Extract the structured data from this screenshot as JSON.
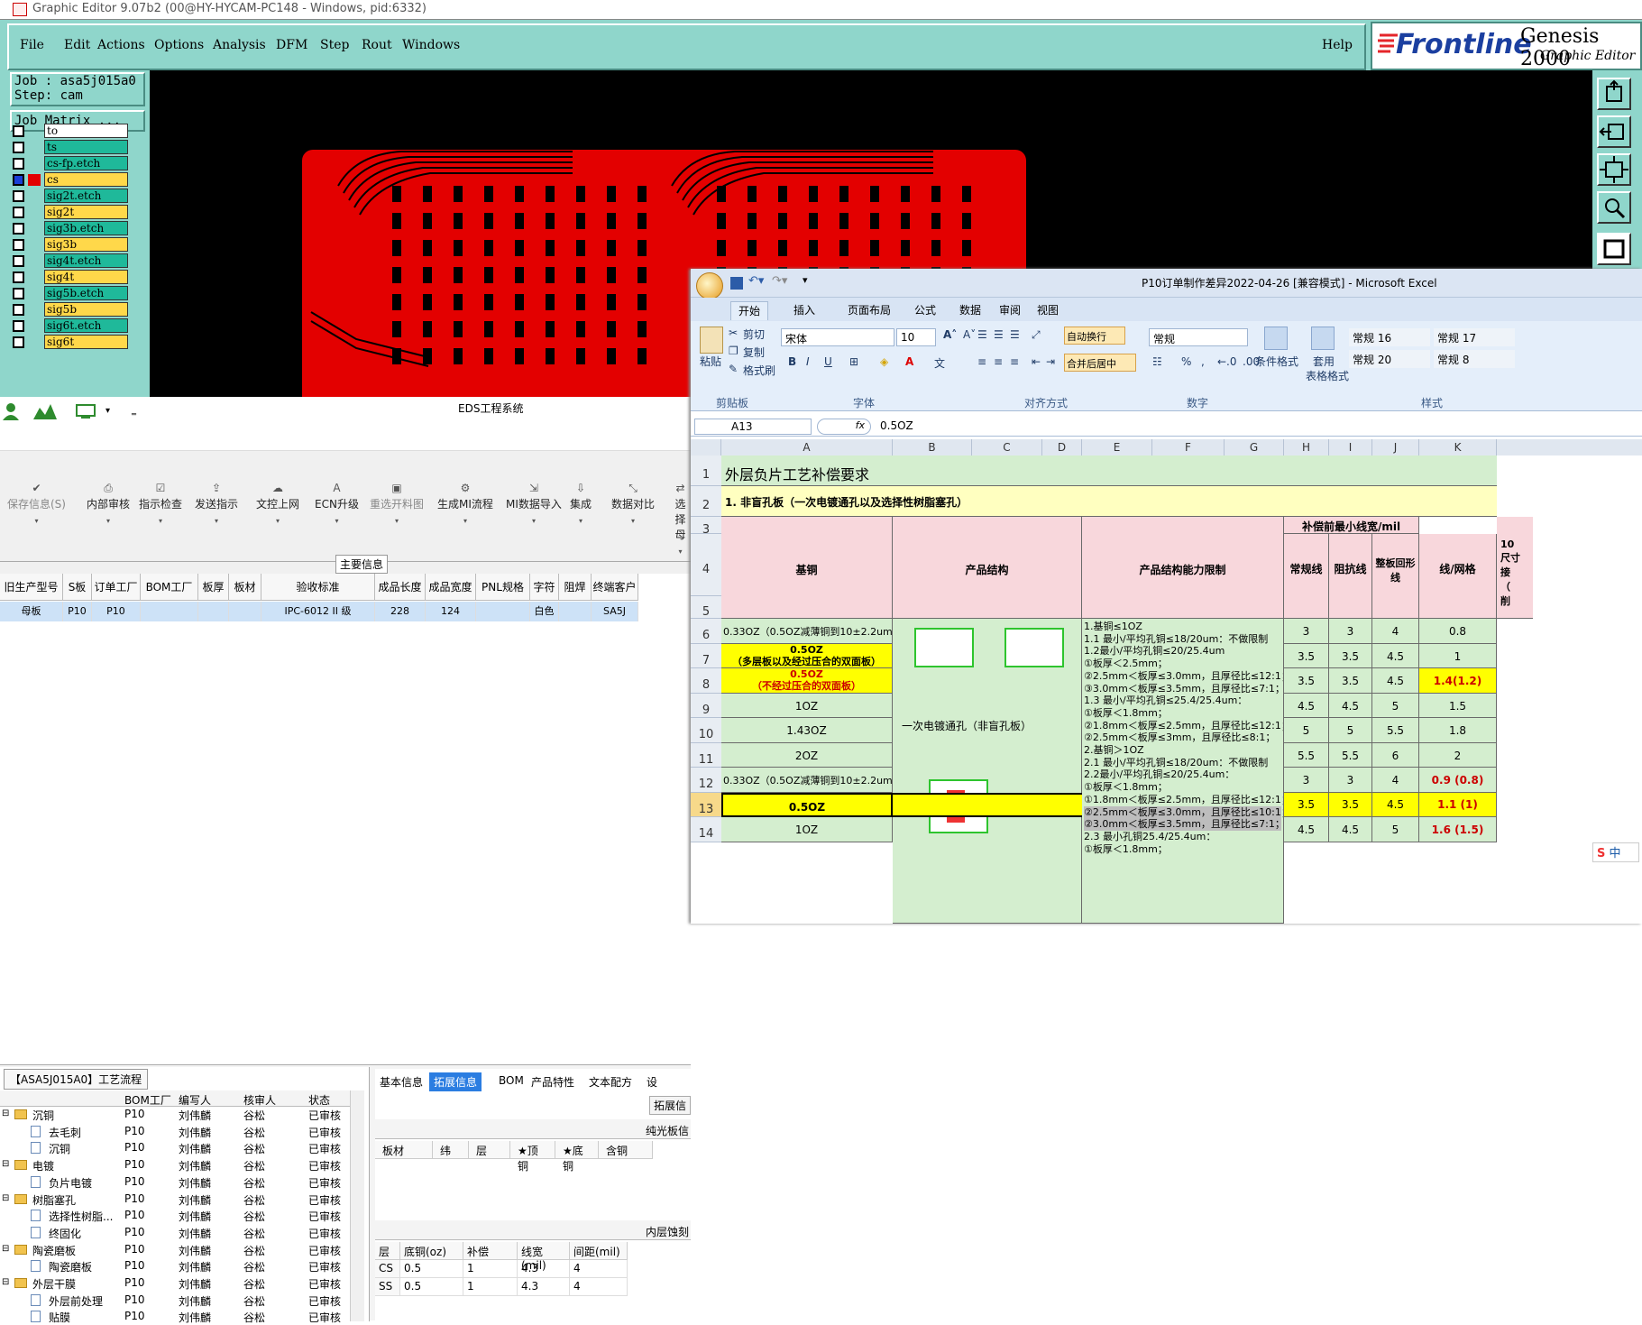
{
  "genesis": {
    "title": "Graphic Editor 9.07b2 (00@HY-HYCAM-PC148 - Windows, pid:6332)",
    "menu": [
      "File",
      "Edit",
      "Actions",
      "Options",
      "Analysis",
      "DFM",
      "Step",
      "Rout",
      "Windows"
    ],
    "help": "Help",
    "logo_brand": "Frontline",
    "logo_product": "Genesis 2000",
    "logo_sub": "Graphic Editor",
    "job": "Job : asa5j015a0",
    "step": "Step: cam",
    "job_matrix": "Job Matrix ...",
    "layers": [
      {
        "name": "to",
        "color": "#ffffff"
      },
      {
        "name": "ts",
        "color": "#1fb99a"
      },
      {
        "name": "cs-fp.etch",
        "color": "#1fb99a"
      },
      {
        "name": "cs",
        "color": "#ffd84a"
      },
      {
        "name": "sig2t.etch",
        "color": "#1fb99a"
      },
      {
        "name": "sig2t",
        "color": "#ffd84a"
      },
      {
        "name": "sig3b.etch",
        "color": "#1fb99a"
      },
      {
        "name": "sig3b",
        "color": "#ffd84a"
      },
      {
        "name": "sig4t.etch",
        "color": "#1fb99a"
      },
      {
        "name": "sig4t",
        "color": "#ffd84a"
      },
      {
        "name": "sig5b.etch",
        "color": "#1fb99a"
      },
      {
        "name": "sig5b",
        "color": "#ffd84a"
      },
      {
        "name": "sig6t.etch",
        "color": "#1fb99a"
      },
      {
        "name": "sig6t",
        "color": "#ffd84a"
      }
    ],
    "pcb_color": "#e30000"
  },
  "eds": {
    "title": "EDS工程系统",
    "tools": [
      {
        "label": "保存信息(S)",
        "icon": "✔",
        "disabled": true
      },
      {
        "label": "内部审核",
        "icon": "⎙"
      },
      {
        "label": "指示检查",
        "icon": "☑"
      },
      {
        "label": "发送指示",
        "icon": "⇪"
      },
      {
        "label": "文控上网",
        "icon": "☁"
      },
      {
        "label": "ECN升级",
        "icon": "A"
      },
      {
        "label": "重选开料图",
        "icon": "▣",
        "disabled": true
      },
      {
        "label": "生成MI流程",
        "icon": "⚙"
      },
      {
        "label": "MI数据导入",
        "icon": "⇲"
      },
      {
        "label": "集成",
        "icon": "⇩"
      },
      {
        "label": "数据对比",
        "icon": "⤡"
      },
      {
        "label": "选择母",
        "icon": "⇄"
      }
    ],
    "section": "主要信息",
    "grid_headers": [
      "旧生产型号",
      "S板",
      "订单工厂",
      "BOM工厂",
      "板厚",
      "板材",
      "验收标准",
      "成品长度",
      "成品宽度",
      "PNL规格",
      "字符",
      "阻焊",
      "终端客户"
    ],
    "grid_row": [
      "母板",
      "P10",
      "P10",
      "",
      "",
      "",
      "IPC-6012 II 级",
      "228",
      "124",
      "",
      "白色",
      "",
      "SA5J"
    ],
    "flow_tab": "【ASA5J015A0】工艺流程",
    "flow_headers": [
      "BOM工厂",
      "编写人",
      "核审人",
      "状态"
    ],
    "flow_rows": [
      {
        "name": "沉铜",
        "level": 0,
        "folder": true,
        "f": "P10",
        "w": "刘伟麟",
        "c": "谷松",
        "s": "已审核"
      },
      {
        "name": "去毛刺",
        "level": 1,
        "f": "P10",
        "w": "刘伟麟",
        "c": "谷松",
        "s": "已审核"
      },
      {
        "name": "沉铜",
        "level": 1,
        "f": "P10",
        "w": "刘伟麟",
        "c": "谷松",
        "s": "已审核"
      },
      {
        "name": "电镀",
        "level": 0,
        "folder": true,
        "f": "P10",
        "w": "刘伟麟",
        "c": "谷松",
        "s": "已审核"
      },
      {
        "name": "负片电镀",
        "level": 1,
        "f": "P10",
        "w": "刘伟麟",
        "c": "谷松",
        "s": "已审核"
      },
      {
        "name": "树脂塞孔",
        "level": 0,
        "folder": true,
        "f": "P10",
        "w": "刘伟麟",
        "c": "谷松",
        "s": "已审核"
      },
      {
        "name": "选择性树脂...",
        "level": 1,
        "f": "P10",
        "w": "刘伟麟",
        "c": "谷松",
        "s": "已审核"
      },
      {
        "name": "终固化",
        "level": 1,
        "f": "P10",
        "w": "刘伟麟",
        "c": "谷松",
        "s": "已审核"
      },
      {
        "name": "陶瓷磨板",
        "level": 0,
        "folder": true,
        "f": "P10",
        "w": "刘伟麟",
        "c": "谷松",
        "s": "已审核"
      },
      {
        "name": "陶瓷磨板",
        "level": 1,
        "f": "P10",
        "w": "刘伟麟",
        "c": "谷松",
        "s": "已审核"
      },
      {
        "name": "外层干膜",
        "level": 0,
        "folder": true,
        "f": "P10",
        "w": "刘伟麟",
        "c": "谷松",
        "s": "已审核"
      },
      {
        "name": "外层前处理",
        "level": 1,
        "f": "P10",
        "w": "刘伟麟",
        "c": "谷松",
        "s": "已审核"
      },
      {
        "name": "贴膜",
        "level": 1,
        "f": "P10",
        "w": "刘伟麟",
        "c": "谷松",
        "s": "已审核"
      }
    ],
    "tabs": [
      "基本信息",
      "拓展信息",
      "BOM",
      "产品特性",
      "文本配方",
      "设"
    ],
    "active_tab": "拓展信息",
    "ext_label": "拓展信",
    "pure_label": "纯光板信",
    "pure_headers": [
      "板材",
      "纬",
      "层",
      "★顶铜",
      "★底铜",
      "含铜"
    ],
    "inner_label": "内层蚀刻",
    "inner_headers": [
      "层",
      "底铜(oz)",
      "补偿",
      "线宽(mil)",
      "间距(mil)"
    ],
    "inner_rows": [
      [
        "CS",
        "0.5",
        "1",
        "4.3",
        "4"
      ],
      [
        "SS",
        "0.5",
        "1",
        "4.3",
        "4"
      ]
    ]
  },
  "excel": {
    "title": "P10订单制作差异2022-04-26 [兼容模式] - Microsoft Excel",
    "tabs": [
      "开始",
      "插入",
      "页面布局",
      "公式",
      "数据",
      "审阅",
      "视图"
    ],
    "clipboard": {
      "paste": "粘贴",
      "cut": "剪切",
      "copy": "复制",
      "format": "格式刷",
      "group": "剪贴板"
    },
    "font": {
      "name": "宋体",
      "size": "10",
      "group": "字体"
    },
    "align": {
      "wrap": "自动换行",
      "merge": "合并后居中",
      "group": "对齐方式"
    },
    "number": {
      "format": "常规",
      "group": "数字"
    },
    "styles": {
      "cond": "条件格式",
      "table1": "套用",
      "table2": "表格格式",
      "group": "样式",
      "s1": "常规 16",
      "s2": "常规 17",
      "s3": "常规 20",
      "s4": "常规 8"
    },
    "namebox": "A13",
    "fx": "fx",
    "formula": "0.5OZ",
    "columns": [
      "A",
      "B",
      "C",
      "D",
      "E",
      "F",
      "G",
      "H",
      "I",
      "J",
      "K"
    ],
    "rows": [
      "1",
      "2",
      "3",
      "4",
      "5",
      "6",
      "7",
      "8",
      "9",
      "10",
      "11",
      "12",
      "13",
      "14"
    ],
    "sheet_title": "外层负片工艺补偿要求",
    "section1": "1. 非盲孔板（一次电镀通孔以及选择性树脂塞孔）",
    "h_base": "基铜",
    "h_struct": "产品结构",
    "h_limit": "产品结构能力限制",
    "h_min": "补偿前最小线宽/mil",
    "h_normal": "常规线",
    "h_imp": "阻抗线",
    "h_ring": "整板回形线",
    "h_grid": "线/网格",
    "h_extra": "10",
    "h_extra2": [
      "尺寸",
      "接",
      "（",
      "削"
    ],
    "base_vals": [
      "0.33OZ（0.5OZ减薄铜到10±2.2um）",
      "0.5OZ",
      "（多层板以及经过压合的双面板）",
      "0.5OZ",
      "（不经过压合的双面板）",
      "1OZ",
      "1.43OZ",
      "2OZ",
      "0.33OZ（0.5OZ减薄铜到10±2.2um）",
      "0.5OZ",
      "1OZ"
    ],
    "struct_text": "一次电镀通孔（非盲孔板）",
    "limit_lines": [
      "1.基铜≤1OZ",
      "1.1 最小/平均孔铜≤18/20um：不做限制",
      "1.2最小/平均孔铜≤20/25.4um",
      "①板厚＜2.5mm；",
      "②2.5mm＜板厚≤3.0mm，且厚径比≤12:1；",
      "③3.0mm＜板厚≤3.5mm，且厚径比≤7:1；",
      "1.3 最小/平均孔铜≤25.4/25.4um：",
      "①板厚＜1.8mm；",
      "②1.8mm＜板厚≤2.5mm，且厚径比≤12:1；",
      "②2.5mm＜板厚≤3mm，且厚径比≤8:1；",
      "2.基铜＞1OZ",
      "2.1 最小/平均孔铜≤18/20um：不做限制",
      "2.2最小/平均孔铜≤20/25.4um：",
      "①板厚＜1.8mm；",
      "①1.8mm＜板厚≤2.5mm，且厚径比≤12:1；",
      "②2.5mm＜板厚≤3.0mm，且厚径比≤10:1；",
      "②3.0mm＜板厚≤3.5mm，且厚径比≤7:1；",
      "2.3 最小孔铜25.4/25.4um：",
      "①板厚＜1.8mm；"
    ],
    "vals": [
      [
        "3",
        "3",
        "4",
        "0.8"
      ],
      [
        "3.5",
        "3.5",
        "4.5",
        "1"
      ],
      [
        "3.5",
        "3.5",
        "4.5",
        "1.4(1.2)"
      ],
      [
        "4.5",
        "4.5",
        "5",
        "1.5"
      ],
      [
        "5",
        "5",
        "5.5",
        "1.8"
      ],
      [
        "5.5",
        "5.5",
        "6",
        "2"
      ],
      [
        "3",
        "3",
        "4",
        "0.9 (0.8)"
      ],
      [
        "3.5",
        "3.5",
        "4.5",
        "1.1 (1)"
      ],
      [
        "4.5",
        "4.5",
        "5",
        "1.6 (1.5)"
      ]
    ],
    "ime": "中"
  }
}
